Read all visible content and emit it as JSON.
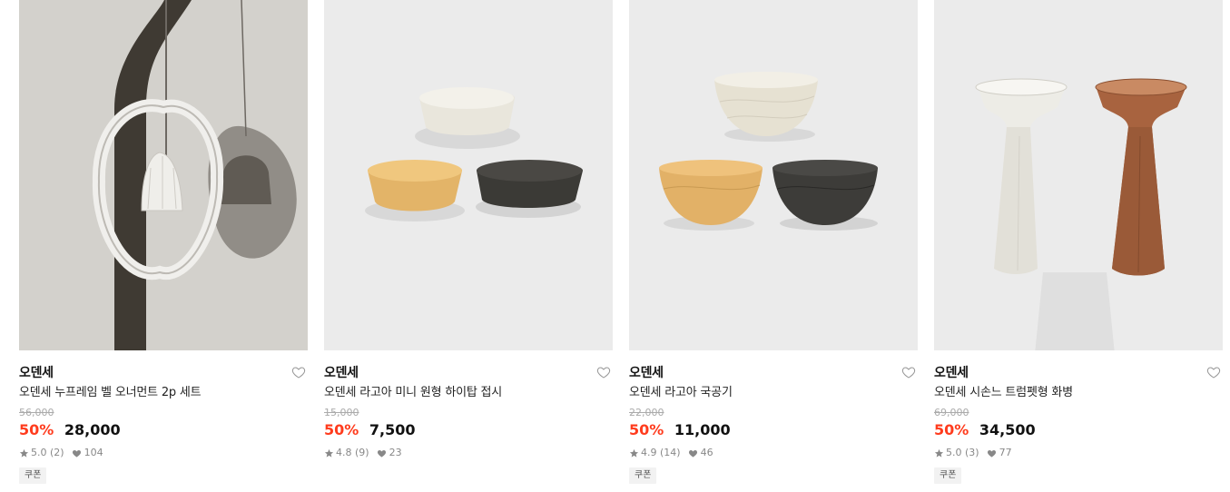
{
  "products": [
    {
      "brand": "오덴세",
      "name": "오덴세 누프레임 벨 오너먼트 2p 세트",
      "original_price": "56,000",
      "discount": "50%",
      "price": "28,000",
      "rating": "5.0",
      "reviews": "(2)",
      "likes": "104",
      "badge": "쿠폰"
    },
    {
      "brand": "오덴세",
      "name": "오덴세 라고아 미니 원형 하이탑 접시",
      "original_price": "15,000",
      "discount": "50%",
      "price": "7,500",
      "rating": "4.8",
      "reviews": "(9)",
      "likes": "23"
    },
    {
      "brand": "오덴세",
      "name": "오덴세 라고아 국공기",
      "original_price": "22,000",
      "discount": "50%",
      "price": "11,000",
      "rating": "4.9",
      "reviews": "(14)",
      "likes": "46",
      "badge": "쿠폰"
    },
    {
      "brand": "오덴세",
      "name": "오덴세 시손느 트럼펫형 화병",
      "original_price": "69,000",
      "discount": "50%",
      "price": "34,500",
      "rating": "5.0",
      "reviews": "(3)",
      "likes": "77",
      "badge": "쿠폰"
    }
  ],
  "icons": {
    "wishlist": "heart-outline-icon",
    "rating": "star-icon",
    "likes": "heart-icon"
  },
  "colors": {
    "discount": "#ff3c1e",
    "strikethrough": "#aaaaaa",
    "meta": "#888888"
  }
}
